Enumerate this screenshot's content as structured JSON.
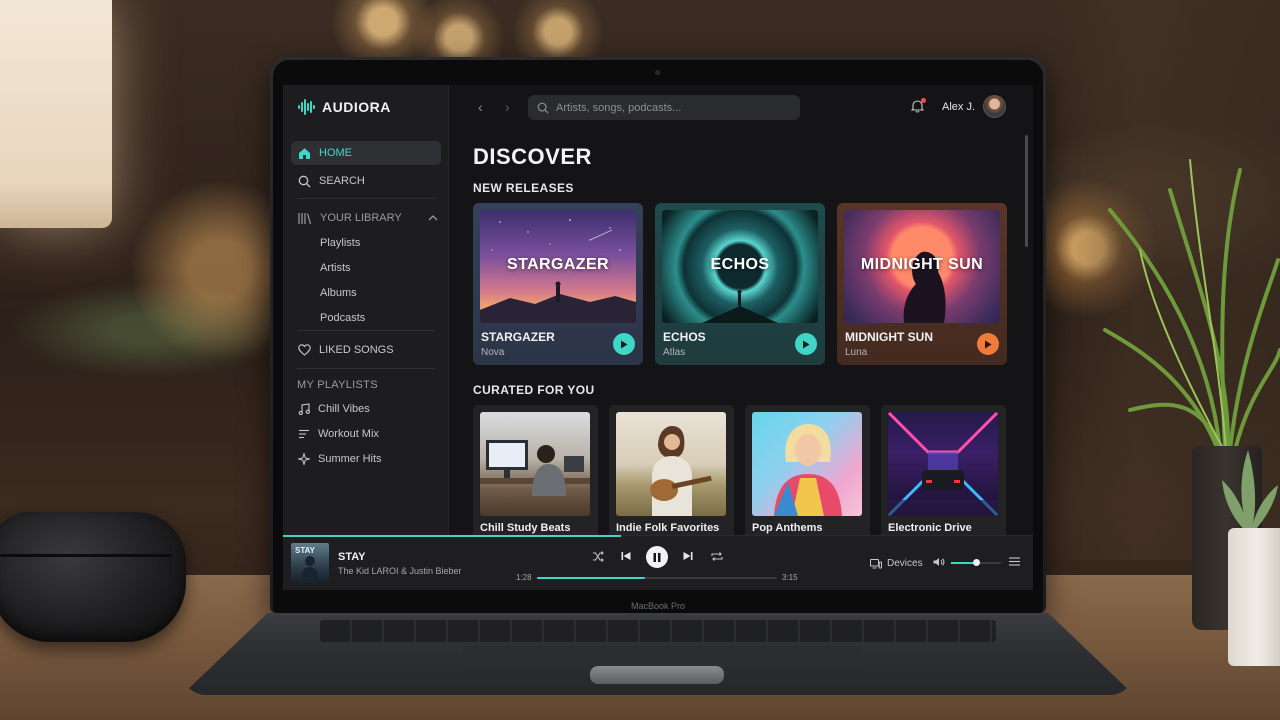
{
  "brand": {
    "name": "AUDIORA",
    "accent": "#3fd6c6"
  },
  "sidebar": {
    "nav": [
      {
        "label": "HOME",
        "icon": "home-icon",
        "active": true
      },
      {
        "label": "SEARCH",
        "icon": "search-icon",
        "active": false
      }
    ],
    "library": {
      "label": "YOUR LIBRARY",
      "icon": "library-icon",
      "expanded": true,
      "items": [
        "Playlists",
        "Artists",
        "Albums",
        "Podcasts"
      ]
    },
    "liked": {
      "label": "LIKED SONGS",
      "icon": "heart-icon"
    },
    "playlists": {
      "label": "MY PLAYLISTS",
      "items": [
        {
          "label": "Chill Vibes",
          "icon": "music-note-icon"
        },
        {
          "label": "Workout Mix",
          "icon": "list-icon"
        },
        {
          "label": "Summer Hits",
          "icon": "sparkle-icon"
        }
      ]
    }
  },
  "topbar": {
    "search_placeholder": "Artists, songs, podcasts...",
    "user_name": "Alex J.",
    "has_notification": true
  },
  "main": {
    "title": "DISCOVER",
    "new_releases": {
      "title": "NEW RELEASES",
      "items": [
        {
          "art_text": "STARGAZER",
          "title": "STARGAZER",
          "artist": "Nova",
          "play_color": "#3fd6c6"
        },
        {
          "art_text": "ECHOS",
          "title": "ECHOS",
          "artist": "Atlas",
          "play_color": "#3fd6c6"
        },
        {
          "art_text": "MIDNIGHT SUN",
          "title": "MIDNIGHT SUN",
          "artist": "Luna",
          "play_color": "#f07a3a"
        }
      ]
    },
    "curated": {
      "title": "CURATED FOR YOU",
      "items": [
        {
          "title": "Chill Study Beats"
        },
        {
          "title": "Indie Folk Favorites"
        },
        {
          "title": "Pop Anthems"
        },
        {
          "title": "Electronic Drive"
        }
      ]
    }
  },
  "player": {
    "art_text": "STAY",
    "title": "STAY",
    "artist": "The Kid LAROI & Justin Bieber",
    "elapsed": "1:28",
    "duration": "3:15",
    "progress": 0.45,
    "devices_label": "Devices",
    "volume": 0.5
  },
  "laptop": {
    "model_label": "MacBook Pro"
  }
}
